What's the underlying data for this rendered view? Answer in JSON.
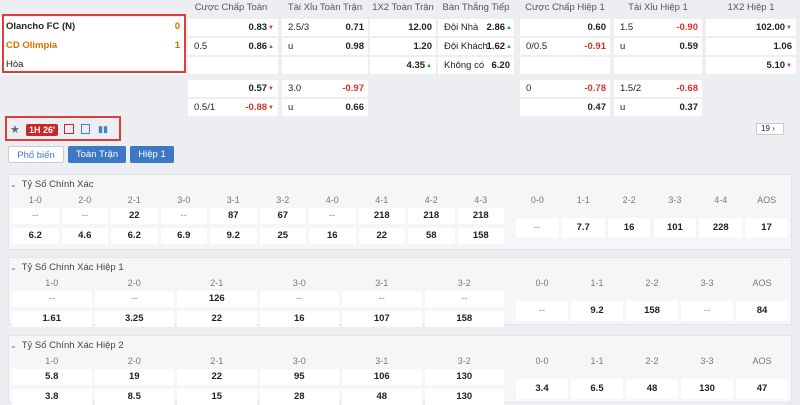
{
  "header_cols": [
    "Cược Chấp Toàn Trận",
    "Tài Xỉu Toàn Trận",
    "1X2 Toàn Trận",
    "Bàn Thắng Tiếp Theo",
    "Cược Chấp Hiệp 1",
    "Tài Xỉu Hiệp 1",
    "1X2 Hiệp 1"
  ],
  "teams": {
    "home": "Olancho FC (N)",
    "home_score": "0",
    "away": "CD Olimpia",
    "away_score": "1",
    "draw": "Hòa"
  },
  "main_rows": [
    {
      "hc_line": "",
      "hc_home": "0.83",
      "ou_line": "2.5/3",
      "ou_over": "0.71",
      "x12": "12.00",
      "next_label": "Đội Nhà",
      "next_val": "2.86",
      "h1hc_line": "",
      "h1hc_val": "0.60",
      "h1ou_line": "1.5",
      "h1ou_val": "-0.90",
      "h1x12": "102.00"
    },
    {
      "hc_line": "0.5",
      "hc_home": "0.86",
      "ou_line": "u",
      "ou_over": "0.98",
      "x12": "1.20",
      "next_label": "Đội Khách",
      "next_val": "1.62",
      "h1hc_line": "0/0.5",
      "h1hc_val": "-0.91",
      "h1ou_line": "u",
      "h1ou_val": "0.59",
      "h1x12": "1.06"
    },
    {
      "x12": "4.35",
      "next_label": "Không có",
      "next_val": "6.20",
      "h1x12": "5.10"
    }
  ],
  "alt_rows": [
    {
      "hc_line": "",
      "hc_home": "0.57",
      "ou_line": "3.0",
      "ou_over": "-0.97",
      "h1hc_line": "0",
      "h1hc_val": "-0.78",
      "h1ou_line": "1.5/2",
      "h1ou_val": "-0.68"
    },
    {
      "hc_line": "0.5/1",
      "hc_home": "-0.88",
      "ou_line": "u",
      "ou_over": "0.66",
      "h1hc_line": "",
      "h1hc_val": "0.47",
      "h1ou_line": "u",
      "h1ou_val": "0.37"
    }
  ],
  "toolbar": {
    "live": "1H 26'",
    "count": "19"
  },
  "tabs": [
    "Phổ biến",
    "Toàn Trận",
    "Hiệp 1"
  ],
  "sections": [
    {
      "title": "Tỷ Số Chính Xác",
      "left_heads": [
        "1-0",
        "2-0",
        "2-1",
        "3-0",
        "3-1",
        "3-2",
        "4-0",
        "4-1",
        "4-2",
        "4-3"
      ],
      "left_r1": [
        "--",
        "--",
        "22",
        "--",
        "87",
        "67",
        "--",
        "218",
        "218",
        "218"
      ],
      "left_r2": [
        "6.2",
        "4.6",
        "6.2",
        "6.9",
        "9.2",
        "25",
        "16",
        "22",
        "58",
        "158"
      ],
      "right_heads": [
        "0-0",
        "1-1",
        "2-2",
        "3-3",
        "4-4",
        "AOS"
      ],
      "right_vals": [
        "--",
        "7.7",
        "16",
        "101",
        "228",
        "17"
      ]
    },
    {
      "title": "Tỷ Số Chính Xác Hiệp 1",
      "left_heads": [
        "1-0",
        "2-0",
        "2-1",
        "3-0",
        "3-1",
        "3-2"
      ],
      "left_r1": [
        "--",
        "--",
        "126",
        "--",
        "--",
        "--"
      ],
      "left_r2": [
        "1.61",
        "3.25",
        "22",
        "16",
        "107",
        "158"
      ],
      "right_heads": [
        "0-0",
        "1-1",
        "2-2",
        "3-3",
        "AOS"
      ],
      "right_vals": [
        "--",
        "9.2",
        "158",
        "--",
        "84"
      ]
    },
    {
      "title": "Tỷ Số Chính Xác Hiệp 2",
      "left_heads": [
        "1-0",
        "2-0",
        "2-1",
        "3-0",
        "3-1",
        "3-2"
      ],
      "left_r1": [
        "5.8",
        "19",
        "22",
        "95",
        "106",
        "130"
      ],
      "left_r2": [
        "3.8",
        "8.5",
        "15",
        "28",
        "48",
        "130"
      ],
      "right_heads": [
        "0-0",
        "1-1",
        "2-2",
        "3-3",
        "AOS"
      ],
      "right_vals": [
        "3.4",
        "6.5",
        "48",
        "130",
        "47"
      ]
    }
  ]
}
